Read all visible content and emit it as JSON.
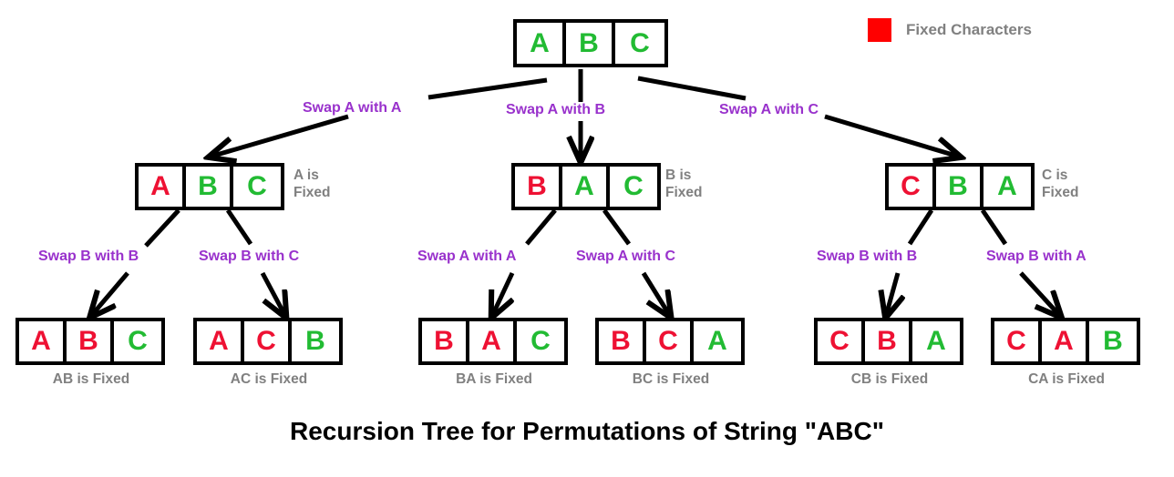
{
  "title": "Recursion Tree for Permutations of String \"ABC\"",
  "legend": {
    "swatch_color": "#ff0000",
    "label": "Fixed Characters"
  },
  "colors": {
    "fixed_char": "#ee1133",
    "free_char": "#22bb33",
    "swap_label": "#9932cc",
    "note": "#808080",
    "edge": "#000000",
    "box_border": "#000000",
    "background": "#ffffff"
  },
  "tree": {
    "root": {
      "cells": [
        {
          "letter": "A",
          "state": "free"
        },
        {
          "letter": "B",
          "state": "free"
        },
        {
          "letter": "C",
          "state": "free"
        }
      ]
    },
    "level1_edges": [
      {
        "label": "Swap A with A"
      },
      {
        "label": "Swap A with B"
      },
      {
        "label": "Swap A with C"
      }
    ],
    "level1_nodes": [
      {
        "cells": [
          {
            "letter": "A",
            "state": "fixed"
          },
          {
            "letter": "B",
            "state": "free"
          },
          {
            "letter": "C",
            "state": "free"
          }
        ],
        "note": "A is\nFixed"
      },
      {
        "cells": [
          {
            "letter": "B",
            "state": "fixed"
          },
          {
            "letter": "A",
            "state": "free"
          },
          {
            "letter": "C",
            "state": "free"
          }
        ],
        "note": "B is\nFixed"
      },
      {
        "cells": [
          {
            "letter": "C",
            "state": "fixed"
          },
          {
            "letter": "B",
            "state": "free"
          },
          {
            "letter": "A",
            "state": "free"
          }
        ],
        "note": "C is\nFixed"
      }
    ],
    "level2_edges": [
      {
        "label": "Swap B with B"
      },
      {
        "label": "Swap B with C"
      },
      {
        "label": "Swap A with A"
      },
      {
        "label": "Swap A with C"
      },
      {
        "label": "Swap B with B"
      },
      {
        "label": "Swap B with A"
      }
    ],
    "leaf_nodes": [
      {
        "cells": [
          {
            "letter": "A",
            "state": "fixed"
          },
          {
            "letter": "B",
            "state": "fixed"
          },
          {
            "letter": "C",
            "state": "free"
          }
        ],
        "note": "AB is Fixed"
      },
      {
        "cells": [
          {
            "letter": "A",
            "state": "fixed"
          },
          {
            "letter": "C",
            "state": "fixed"
          },
          {
            "letter": "B",
            "state": "free"
          }
        ],
        "note": "AC is Fixed"
      },
      {
        "cells": [
          {
            "letter": "B",
            "state": "fixed"
          },
          {
            "letter": "A",
            "state": "fixed"
          },
          {
            "letter": "C",
            "state": "free"
          }
        ],
        "note": "BA is Fixed"
      },
      {
        "cells": [
          {
            "letter": "B",
            "state": "fixed"
          },
          {
            "letter": "C",
            "state": "fixed"
          },
          {
            "letter": "A",
            "state": "free"
          }
        ],
        "note": "BC is Fixed"
      },
      {
        "cells": [
          {
            "letter": "C",
            "state": "fixed"
          },
          {
            "letter": "B",
            "state": "fixed"
          },
          {
            "letter": "A",
            "state": "free"
          }
        ],
        "note": "CB is Fixed"
      },
      {
        "cells": [
          {
            "letter": "C",
            "state": "fixed"
          },
          {
            "letter": "A",
            "state": "fixed"
          },
          {
            "letter": "B",
            "state": "free"
          }
        ],
        "note": "CA is Fixed"
      }
    ]
  }
}
